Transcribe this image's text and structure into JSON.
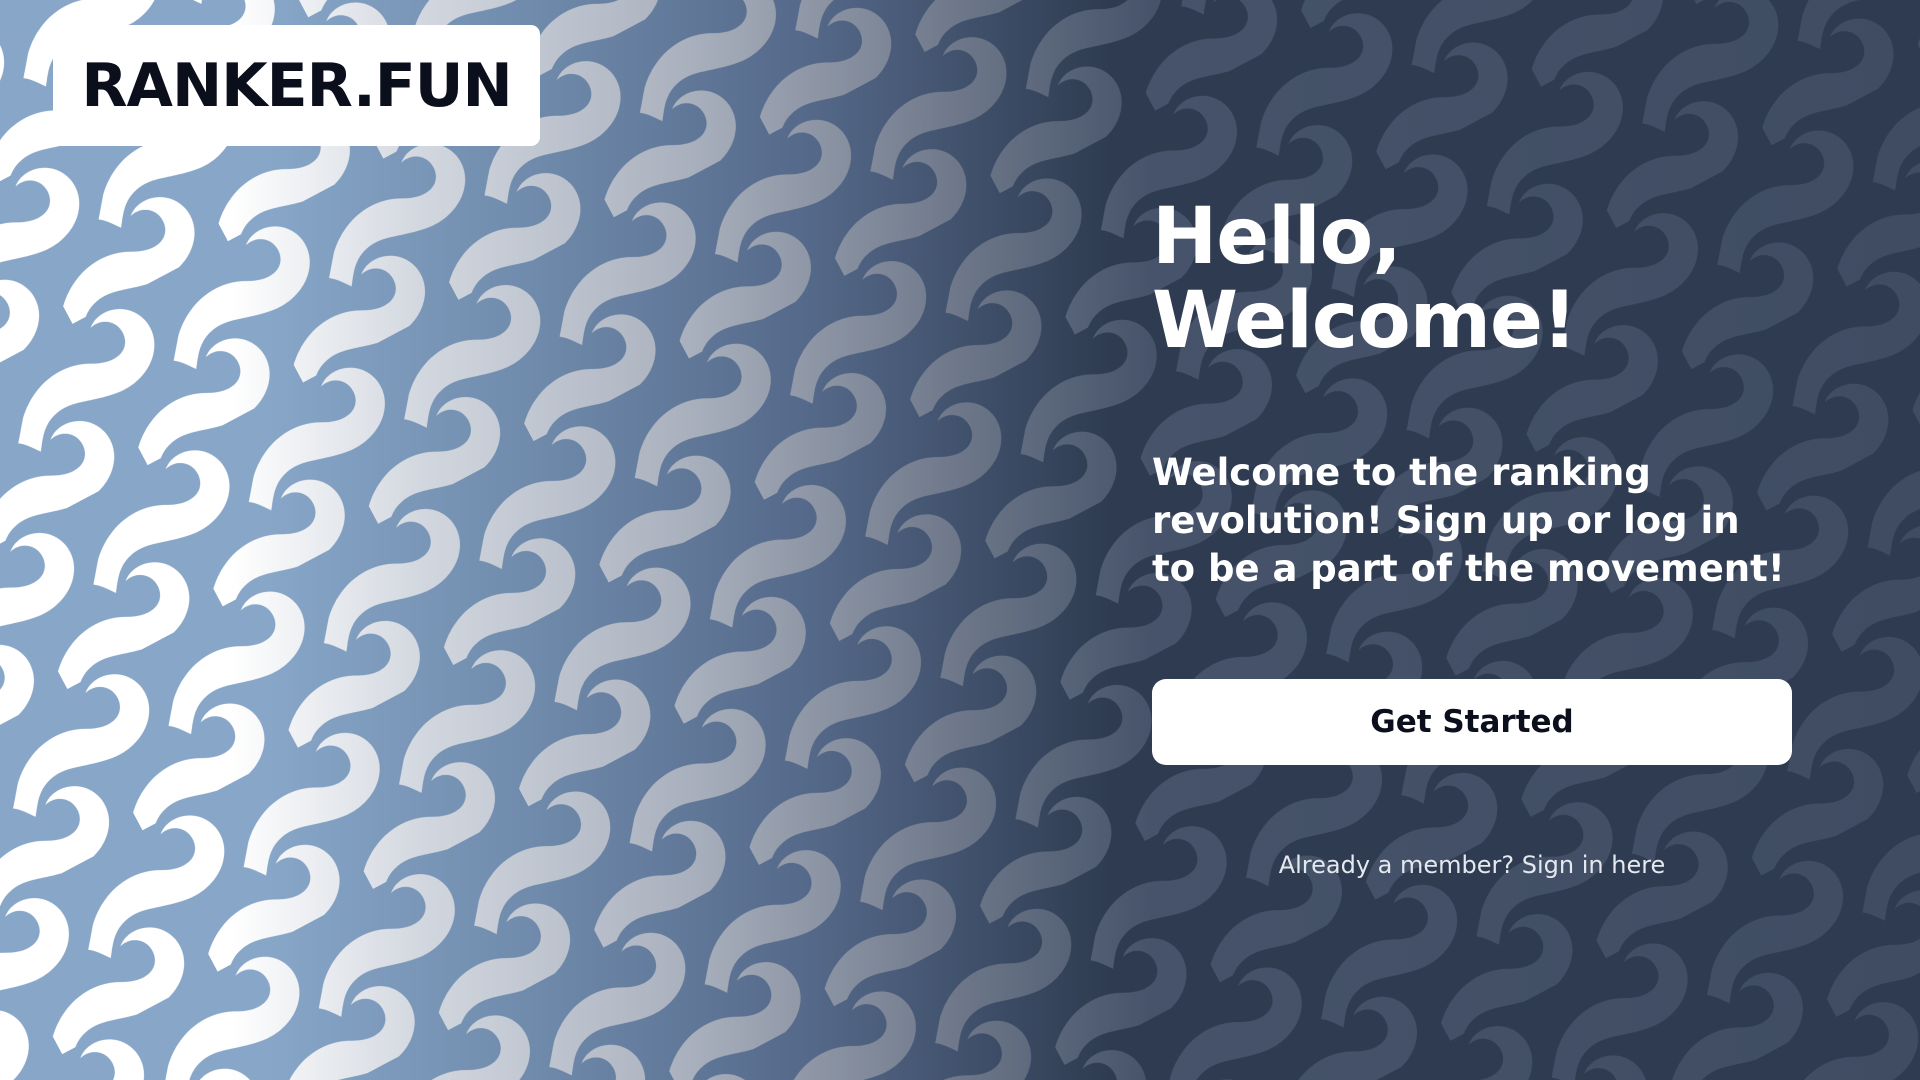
{
  "brand": {
    "logo_text": "RANKER.FUN"
  },
  "hero": {
    "title_line1": "Hello,",
    "title_line2": "Welcome!",
    "subtitle": "Welcome to the ranking revolution! Sign up or log in to be a part of the movement!",
    "primary_button_label": "Get Started",
    "signin_link_label": "Already a member? Sign in here"
  },
  "colors": {
    "background_dark": "#2e3b50",
    "background_light": "#87a6c8",
    "wave_light": "#ffffff",
    "wave_dark": "#3f4c62",
    "logo_text": "#0b0f1c",
    "button_background": "#ffffff",
    "button_text": "#0b0f1c"
  },
  "icons": {
    "background_pattern": "wave-pattern"
  }
}
